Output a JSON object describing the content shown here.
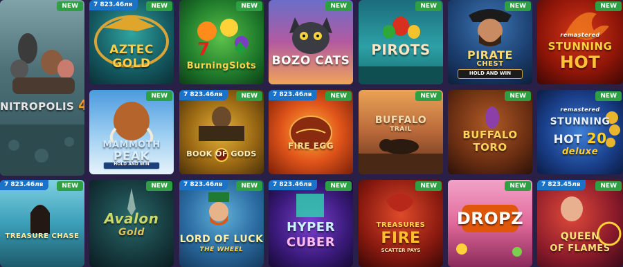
{
  "labels": {
    "new": "NEW"
  },
  "games": {
    "nitropolis": {
      "name": "NITROPOLIS",
      "num": "4"
    },
    "aztec_gold": {
      "name1": "AZTEC",
      "name2": "GOLD",
      "jackpot": "7 823.46лв"
    },
    "burning_slots": {
      "name": "BurningSlots"
    },
    "bozo_cats": {
      "name": "BOZO CATS"
    },
    "pirots": {
      "name": "PIROTS"
    },
    "pirate_chest": {
      "name1": "PIRATE",
      "name2": "CHEST",
      "sub": "HOLD AND WIN"
    },
    "stunning_hot": {
      "tag": "remastered",
      "name1": "STUNNING",
      "name2": "HOT"
    },
    "mammoth_peak": {
      "name1": "MAMMOTH",
      "name2": "PEAK",
      "sub": "HOLD AND WIN"
    },
    "book_of_gods": {
      "name": "BOOK OF GODS",
      "jackpot": "7 823.46лв"
    },
    "fire_egg": {
      "name": "FIRE EGG",
      "jackpot": "7 823.46лв"
    },
    "buffalo_trail": {
      "name1": "BUFFALO",
      "name2": "TRAIL"
    },
    "buffalo_toro": {
      "name1": "BUFFALO",
      "name2": "TORO"
    },
    "stunning_hot_20": {
      "tag": "remastered",
      "name1": "STUNNING",
      "name2": "HOT",
      "num": "20",
      "sub": "deluxe"
    },
    "treasure_chase": {
      "name": "TREASURE CHASE",
      "jackpot": "7 823.46лв"
    },
    "avalon_gold": {
      "name1": "Avalon",
      "name2": "Gold"
    },
    "lord_of_luck": {
      "name1": "LORD OF LUCK",
      "name2": "THE WHEEL",
      "jackpot": "7 823.46лв"
    },
    "hyper_cuber": {
      "name1": "HYPER",
      "name2": "CUBER",
      "jackpot": "7 823.46лв"
    },
    "treasures_of_fire": {
      "name1": "TREASURES",
      "name2": "FIRE",
      "sub": "SCATTER PAYS"
    },
    "dropz": {
      "name": "DROPZ"
    },
    "queen_of_flames": {
      "name1": "QUEEN",
      "name2": "OF FLAMES",
      "jackpot": "7 823.45лв"
    }
  }
}
